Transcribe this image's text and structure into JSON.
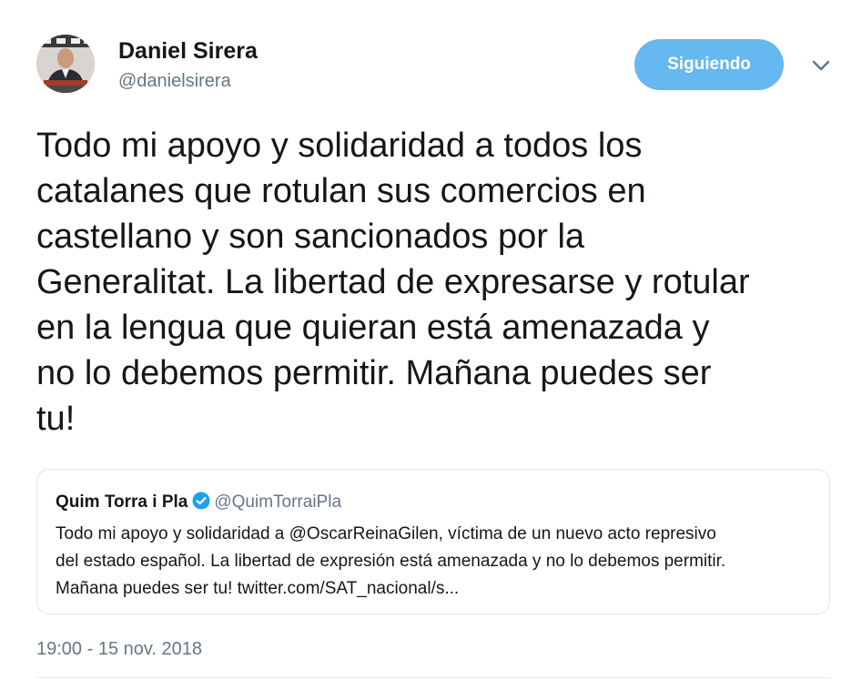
{
  "author": {
    "name": "Daniel Sirera",
    "handle": "@danielsirera",
    "avatar_icon": "profile-photo-man-in-studio"
  },
  "follow_button": {
    "label": "Siguiendo",
    "color": "#66b8f0"
  },
  "menu": {
    "icon": "chevron-down-icon"
  },
  "tweet": {
    "text": "Todo mi apoyo y solidaridad a todos los\ncatalanes que rotulan sus comercios en\ncastellano y son sancionados por la\nGeneralitat. La libertad de expresarse y rotular\nen la lengua que quieran está amenazada y\nno lo debemos permitir. Mañana puedes ser\ntu!"
  },
  "quoted_tweet": {
    "name": "Quim Torra i Pla",
    "verified_icon": "verified-badge-icon",
    "verified_color": "#1da1f2",
    "handle": "@QuimTorraiPla",
    "text": "Todo mi apoyo y solidaridad a @OscarReinaGilen, víctima de un nuevo acto represivo\ndel estado español. La libertad de expresión está amenazada y no lo debemos permitir.\nMañana puedes ser tu! twitter.com/SAT_nacional/s..."
  },
  "timestamp": "19:00 - 15 nov. 2018"
}
